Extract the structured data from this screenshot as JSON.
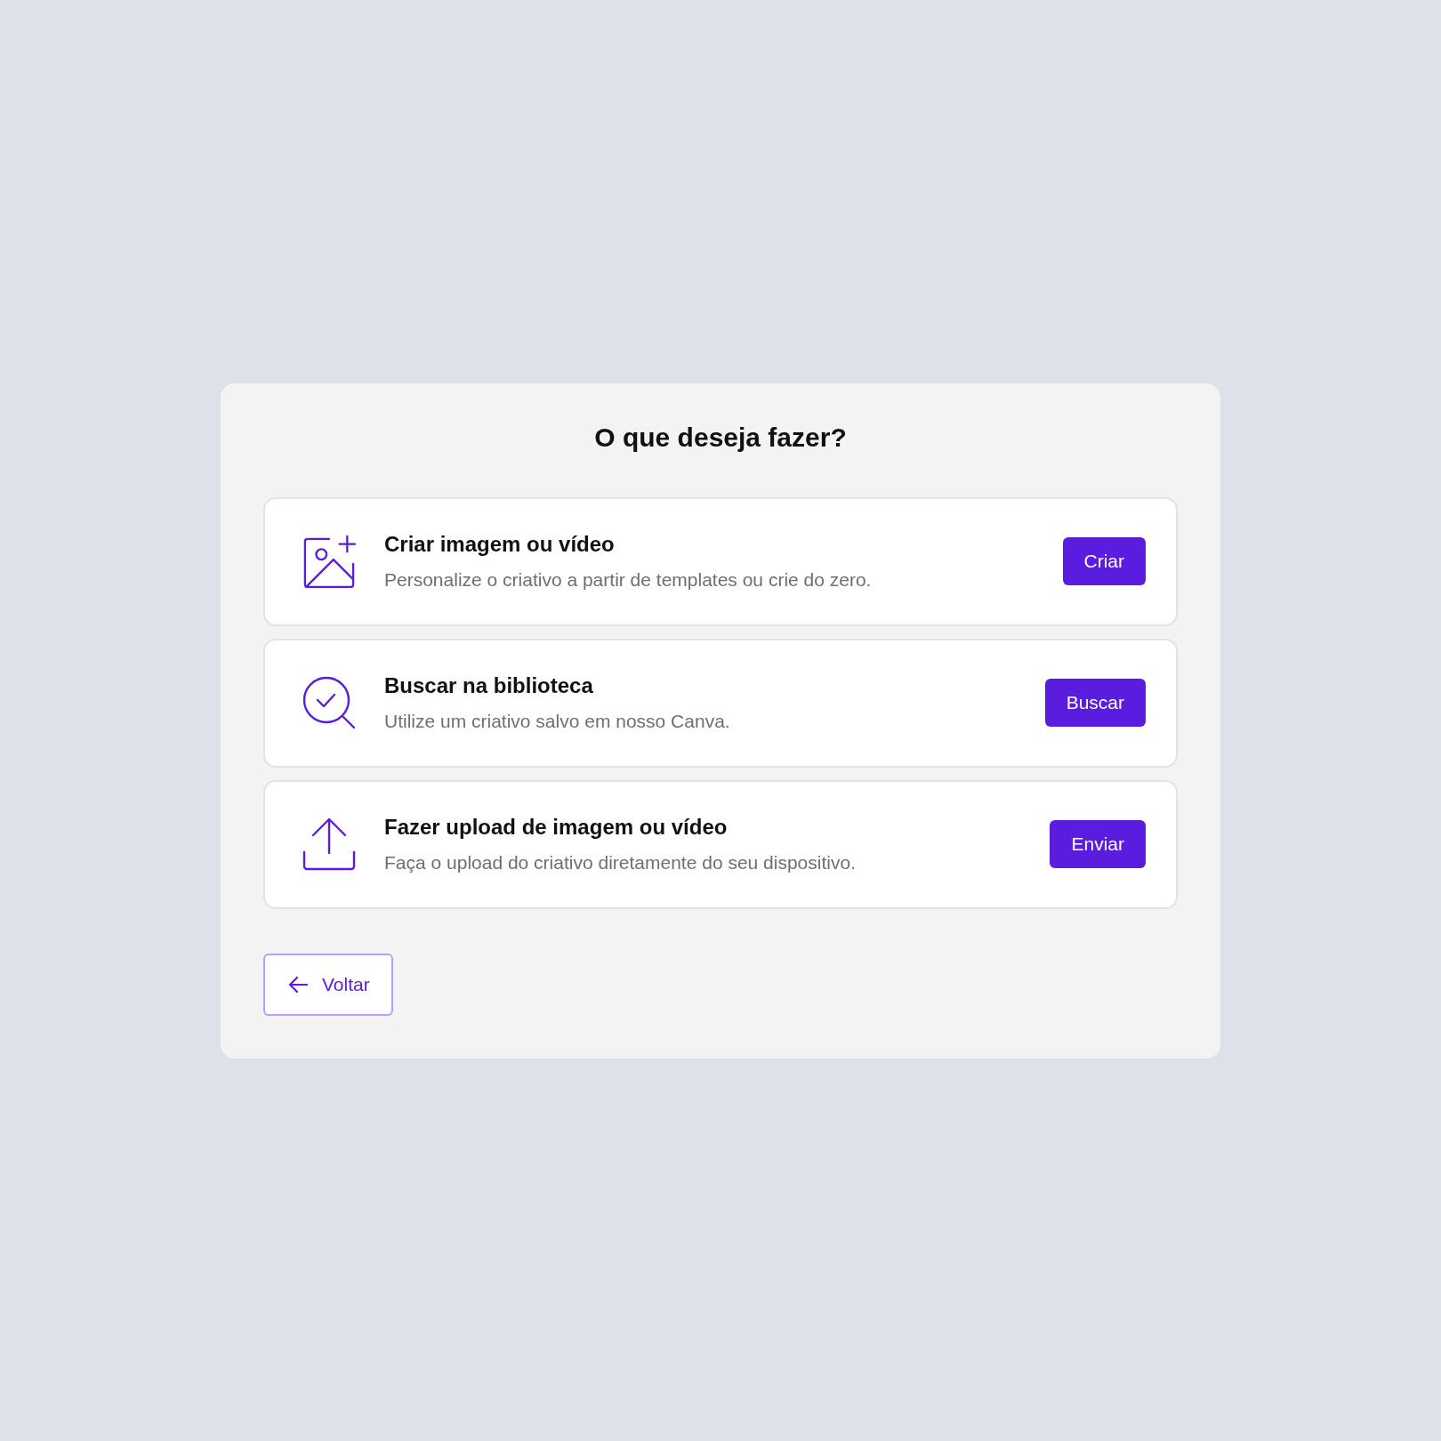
{
  "title": "O que deseja fazer?",
  "options": [
    {
      "kind": "create",
      "heading": "Criar imagem ou vídeo",
      "description": "Personalize o criativo a partir de templates ou crie do zero.",
      "button": "Criar"
    },
    {
      "kind": "library",
      "heading": "Buscar na biblioteca",
      "description": "Utilize um criativo salvo em nosso Canva.",
      "button": "Buscar"
    },
    {
      "kind": "upload",
      "heading": "Fazer upload de imagem ou vídeo",
      "description": "Faça o upload do criativo diretamente do seu dispositivo.",
      "button": "Enviar"
    }
  ],
  "back_button": "Voltar"
}
